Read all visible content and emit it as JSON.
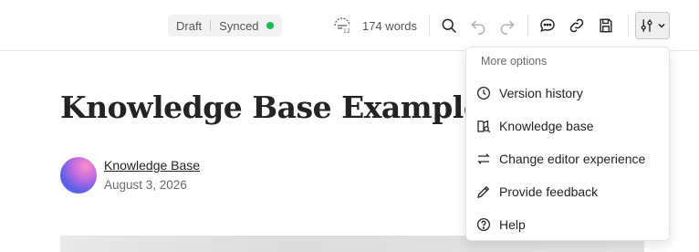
{
  "status": {
    "draft": "Draft",
    "synced": "Synced",
    "synced_color": "#1db954"
  },
  "toolbar": {
    "word_count": "174 words",
    "icons": [
      "word-count-icon",
      "search-icon",
      "undo-icon",
      "redo-icon",
      "comment-icon",
      "link-icon",
      "save-icon",
      "tools-icon",
      "chevron-down-icon"
    ]
  },
  "article": {
    "title": "Knowledge Base Example",
    "author": "Knowledge Base",
    "date": "August 3, 2026"
  },
  "menu": {
    "header": "More options",
    "items": [
      {
        "label": "Version history",
        "icon": "clock-icon"
      },
      {
        "label": "Knowledge base",
        "icon": "knowledge-base-icon"
      },
      {
        "label": "Change editor experience",
        "icon": "swap-icon"
      },
      {
        "label": "Provide feedback",
        "icon": "pencil-icon"
      },
      {
        "label": "Help",
        "icon": "help-icon"
      }
    ]
  }
}
